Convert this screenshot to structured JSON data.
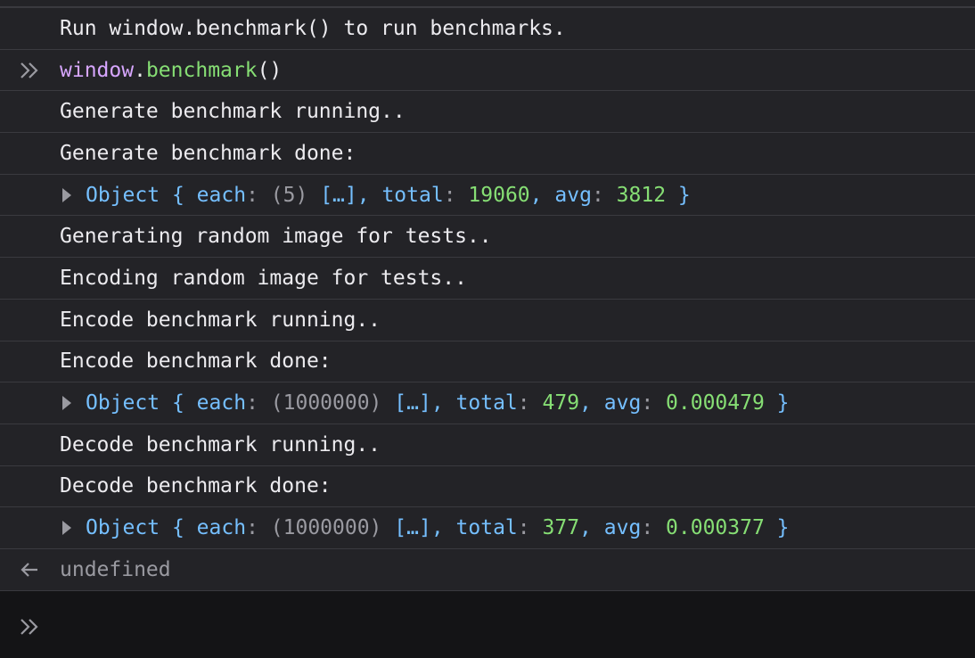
{
  "colors": {
    "background": "#232327",
    "input_background": "#141416",
    "text": "#ecebef",
    "object_blue": "#75bfff",
    "number_green": "#86de74",
    "keyword_purple": "#d7a6ff",
    "muted_gray": "#9a9aa1",
    "divider": "#3a3a3f"
  },
  "rows": {
    "r0": "Run window.benchmark() to run benchmarks.",
    "cmd": {
      "obj": "window",
      "dot": ".",
      "fn": "benchmark",
      "parens": "()"
    },
    "r2": "Generate benchmark running..",
    "r3": "Generate benchmark done:",
    "o1": {
      "name": "Object",
      "open": "{",
      "k1": "each",
      "colon": ":",
      "len": "(5)",
      "arr": "[…]",
      "comma": ",",
      "k2": "total",
      "v2": "19060",
      "k3": "avg",
      "v3": "3812",
      "close": "}"
    },
    "r5": "Generating random image for tests..",
    "r6": "Encoding random image for tests..",
    "r7": "Encode benchmark running..",
    "r8": "Encode benchmark done:",
    "o2": {
      "name": "Object",
      "open": "{",
      "k1": "each",
      "colon": ":",
      "len": "(1000000)",
      "arr": "[…]",
      "comma": ",",
      "k2": "total",
      "v2": "479",
      "k3": "avg",
      "v3": "0.000479",
      "close": "}"
    },
    "r10": "Decode benchmark running..",
    "r11": "Decode benchmark done:",
    "o3": {
      "name": "Object",
      "open": "{",
      "k1": "each",
      "colon": ":",
      "len": "(1000000)",
      "arr": "[…]",
      "comma": ",",
      "k2": "total",
      "v2": "377",
      "k3": "avg",
      "v3": "0.000377",
      "close": "}"
    },
    "result": "undefined"
  },
  "icons": {
    "prompt": "chevron-double-right-icon",
    "result": "arrow-left-icon",
    "expand": "triangle-right-icon"
  }
}
